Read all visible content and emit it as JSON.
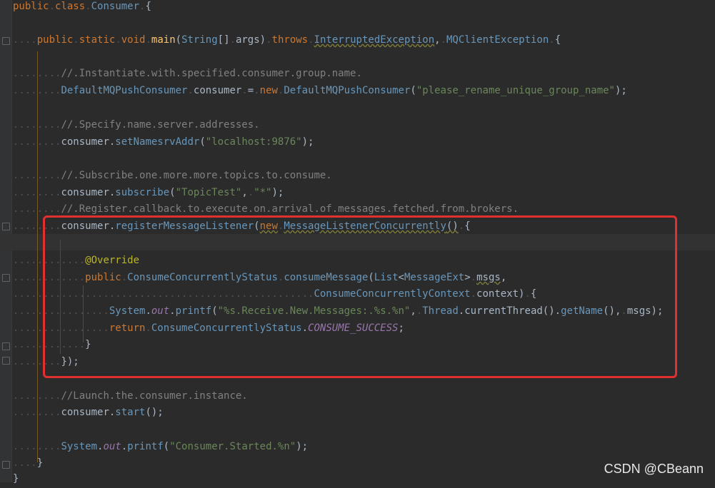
{
  "code_lines": [
    {
      "indent": "",
      "text": "public class Consumer {"
    },
    {
      "indent": "....",
      "text": "public static void main(String[] args) throws InterruptedException, MQClientException {"
    },
    {
      "indent": "........",
      "text": "// Instantiate with specified consumer group name."
    },
    {
      "indent": "........",
      "text": "DefaultMQPushConsumer consumer = new DefaultMQPushConsumer(\"please_rename_unique_group_name\");"
    },
    {
      "indent": "........",
      "text": "// Specify name server addresses."
    },
    {
      "indent": "........",
      "text": "consumer.setNamesrvAddr(\"localhost:9876\");"
    },
    {
      "indent": "........",
      "text": "// Subscribe one more more topics to consume."
    },
    {
      "indent": "........",
      "text": "consumer.subscribe(\"TopicTest\", \"*\");"
    },
    {
      "indent": "........",
      "text": "// Register callback to execute on arrival of messages fetched from brokers."
    },
    {
      "indent": "........",
      "text": "consumer.registerMessageListener(new MessageListenerConcurrently() {"
    },
    {
      "indent": "............",
      "text": "@Override"
    },
    {
      "indent": "............",
      "text": "public ConsumeConcurrentlyStatus consumeMessage(List<MessageExt> msgs,"
    },
    {
      "indent": "..................................................",
      "text": "ConsumeConcurrentlyContext context) {"
    },
    {
      "indent": "................",
      "text": "System.out.printf(\"%s Receive New Messages: %s %n\", Thread.currentThread().getName(), msgs);"
    },
    {
      "indent": "................",
      "text": "return ConsumeConcurrentlyStatus.CONSUME_SUCCESS;"
    },
    {
      "indent": "............",
      "text": "}"
    },
    {
      "indent": "........",
      "text": "});"
    },
    {
      "indent": "........",
      "text": "//Launch the consumer instance."
    },
    {
      "indent": "........",
      "text": "consumer.start();"
    },
    {
      "indent": "........",
      "text": "System.out.printf(\"Consumer Started.%n\");"
    },
    {
      "indent": "....",
      "text": "}"
    },
    {
      "indent": "",
      "text": "}"
    }
  ],
  "watermark": "CSDN @CBeann",
  "colors": {
    "background": "#2b2b2b",
    "keyword": "#cc7832",
    "string": "#6a8759",
    "comment": "#808080",
    "annotation": "#bbb529",
    "highlight_box": "#e03030"
  }
}
